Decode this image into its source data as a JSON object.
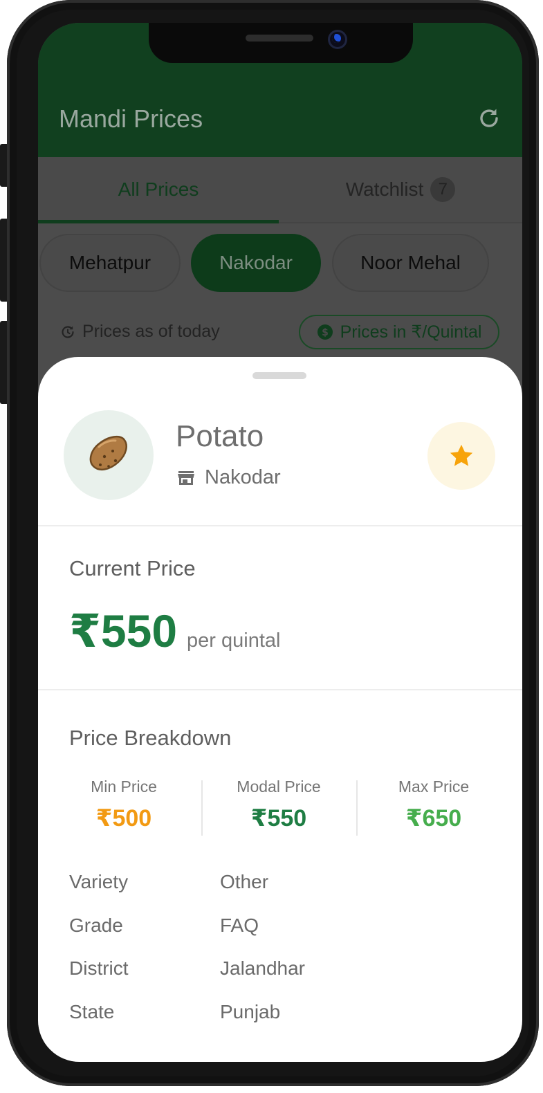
{
  "app": {
    "title": "Mandi Prices",
    "refresh_icon": "refresh-icon"
  },
  "tabs": [
    {
      "label": "All Prices",
      "active": true
    },
    {
      "label": "Watchlist",
      "badge": "7",
      "active": false
    }
  ],
  "markets": [
    {
      "label": "Mehatpur",
      "active": false
    },
    {
      "label": "Nakodar",
      "active": true
    },
    {
      "label": "Noor Mehal",
      "active": false
    }
  ],
  "info": {
    "as_of": "Prices as of today",
    "unit": "Prices in ₹/Quintal"
  },
  "detail": {
    "commodity": "Potato",
    "commodity_icon": "potato-icon",
    "market": "Nakodar",
    "favorite": true,
    "current_price_title": "Current Price",
    "current_price": "₹550",
    "per_unit": "per quintal",
    "breakdown_title": "Price Breakdown",
    "breakdown": [
      {
        "label": "Min Price",
        "value": "₹500",
        "color": "#f29a13"
      },
      {
        "label": "Modal Price",
        "value": "₹550",
        "color": "#1e7d43"
      },
      {
        "label": "Max Price",
        "value": "₹650",
        "color": "#46ad4d"
      }
    ],
    "attributes": [
      {
        "label": "Variety",
        "value": "Other"
      },
      {
        "label": "Grade",
        "value": "FAQ"
      },
      {
        "label": "District",
        "value": "Jalandhar"
      },
      {
        "label": "State",
        "value": "Punjab"
      }
    ]
  },
  "colors": {
    "primary": "#11401f",
    "accent_green": "#1e7d43",
    "star": "#f7a30a"
  }
}
